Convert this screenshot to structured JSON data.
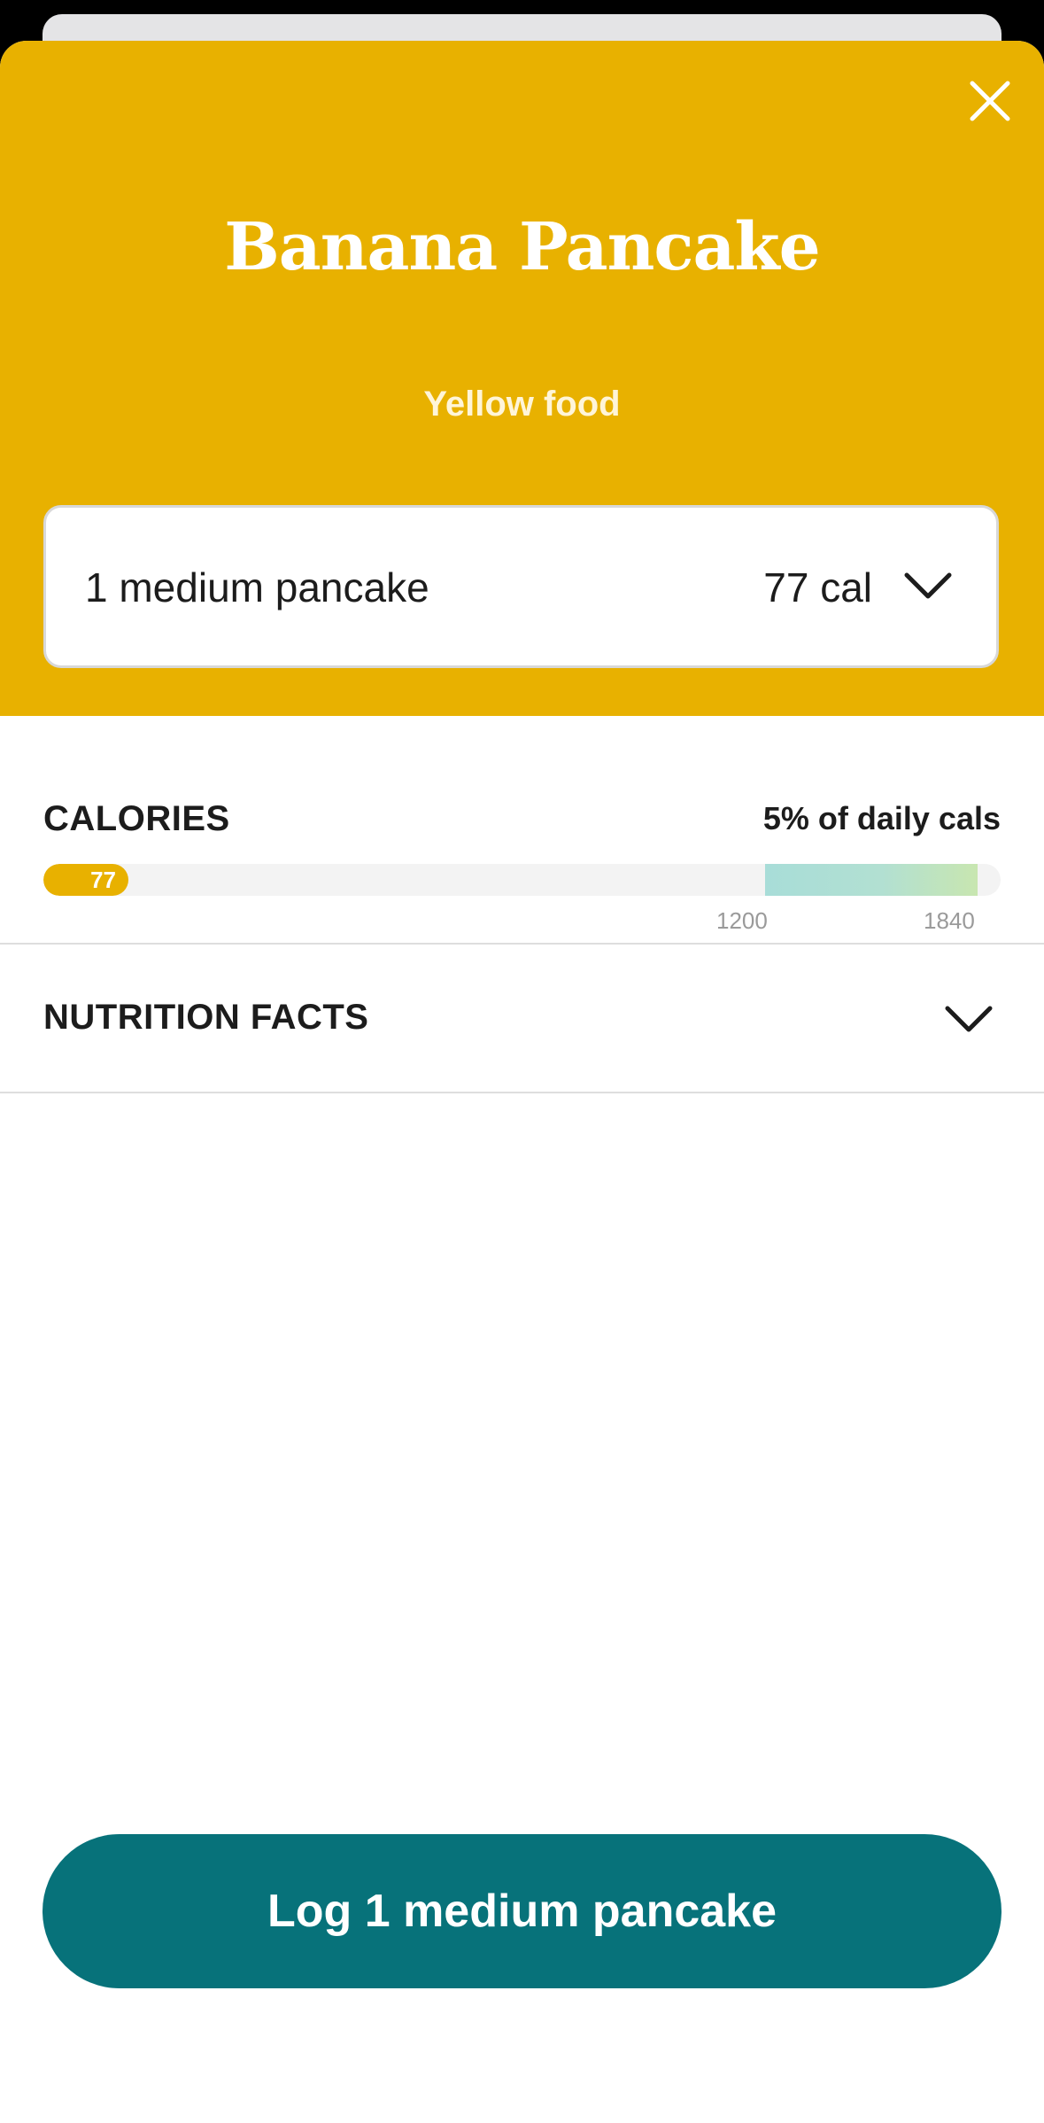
{
  "header": {
    "close_icon": "close-icon",
    "title": "Banana Pancake",
    "subtitle": "Yellow food",
    "accent_color": "#e8b100"
  },
  "serving": {
    "label": "1 medium pancake",
    "calories": "77 cal",
    "chevron_icon": "chevron-down-icon"
  },
  "calories": {
    "heading": "CALORIES",
    "daily_percent_text": "5% of daily cals",
    "value": 77,
    "value_label": "77",
    "tick_low": "1200",
    "tick_high": "1840",
    "fill_color": "#e8b100",
    "target_zone_color": "#a8ddd8"
  },
  "nutrition": {
    "heading": "NUTRITION FACTS",
    "chevron_icon": "chevron-down-icon"
  },
  "log_button": {
    "label": "Log 1 medium pancake",
    "color": "#07727a"
  }
}
